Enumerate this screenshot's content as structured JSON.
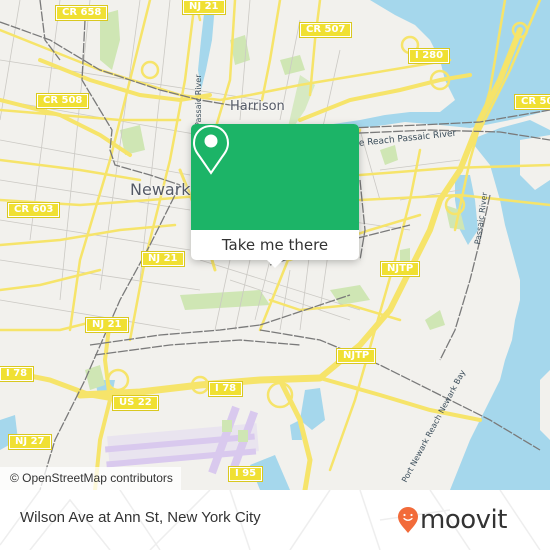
{
  "map": {
    "colors": {
      "land": "#f2f1ed",
      "water": "#a5d7ec",
      "park": "#cfe6b4",
      "major_road": "#f6e46a",
      "minor_road": "#c9c7c2",
      "rail": "#7a7a7a",
      "airport": "#e3d9ef"
    },
    "road_shields": [
      {
        "label": "CR 658"
      },
      {
        "label": "NJ 21"
      },
      {
        "label": "CR 507"
      },
      {
        "label": "I 280"
      },
      {
        "label": "CR 508"
      },
      {
        "label": "CR 50"
      },
      {
        "label": "CR 603"
      },
      {
        "label": "NJ 21"
      },
      {
        "label": "NJ 21"
      },
      {
        "label": "NJTP"
      },
      {
        "label": "NJTP"
      },
      {
        "label": "I 78"
      },
      {
        "label": "I 78"
      },
      {
        "label": "US 22"
      },
      {
        "label": "NJ 27"
      },
      {
        "label": "I 95"
      }
    ],
    "place_labels": [
      {
        "label": "Harrison"
      },
      {
        "label": "Newark"
      }
    ],
    "water_labels": [
      {
        "label": "Passaic River"
      },
      {
        "label": "Dundee Reach Passaic River"
      },
      {
        "label": "Passaic River"
      },
      {
        "label": "Port Newark Reach Newark Bay"
      }
    ],
    "attribution": "© OpenStreetMap contributors"
  },
  "popup": {
    "icon": "location-pin-icon",
    "accent_color": "#1cb467",
    "button_label": "Take me there"
  },
  "footer": {
    "title": "Wilson Ave at Ann St, New York City",
    "brand": "moovit",
    "brand_color": "#f26b3a"
  }
}
